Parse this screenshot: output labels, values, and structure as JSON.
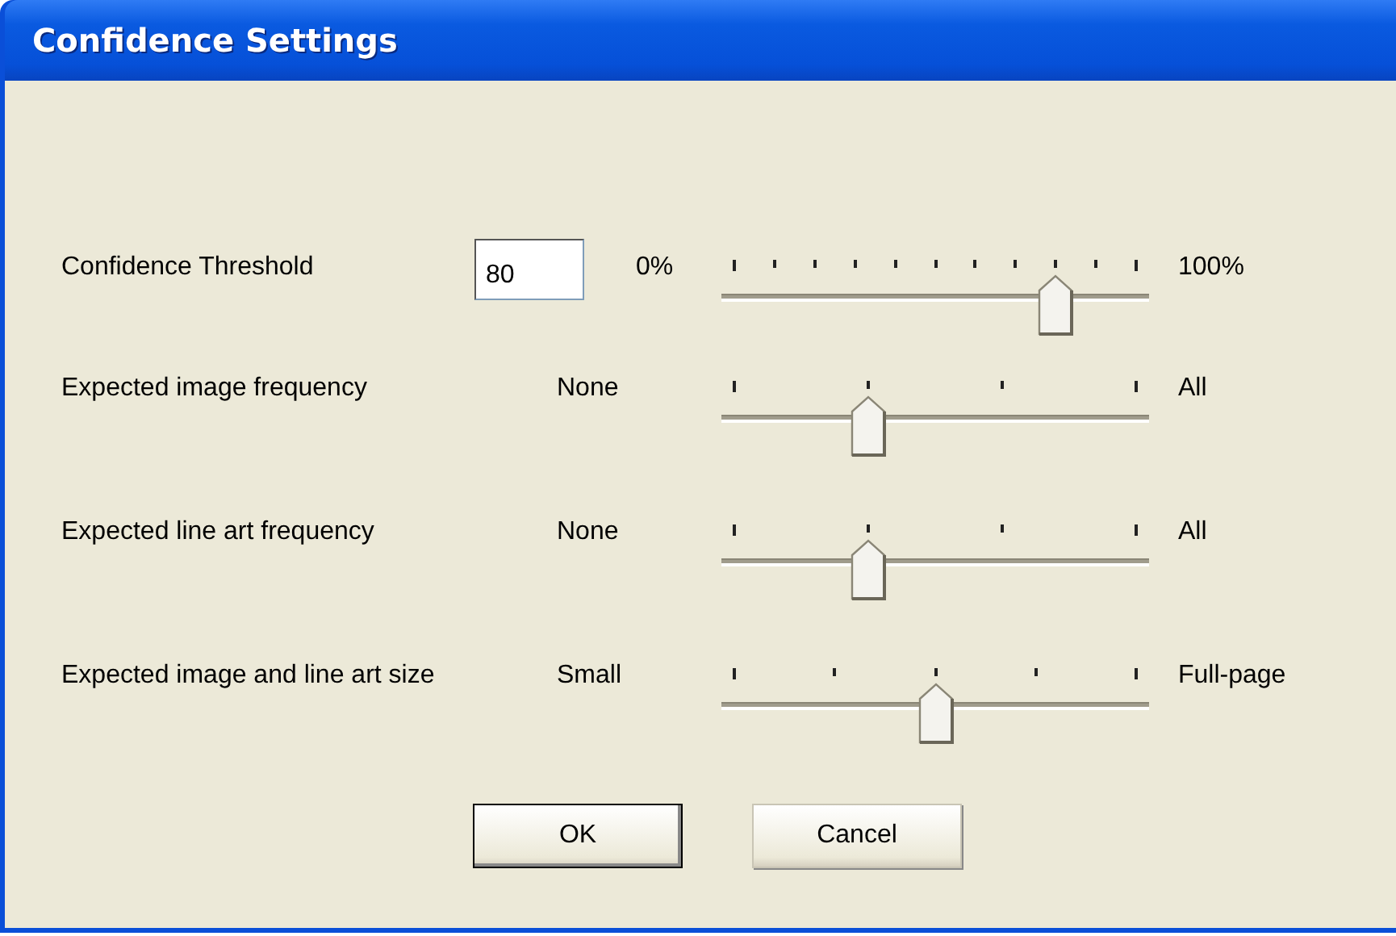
{
  "window": {
    "title": "Confidence Settings"
  },
  "settings": [
    {
      "label": "Confidence Threshold",
      "value": "80",
      "min_label": "0%",
      "max_label": "100%",
      "kind": "tenths",
      "level": 0.8
    },
    {
      "label": "Expected image frequency",
      "min_label": "None",
      "max_label": "All",
      "kind": "thirds",
      "level": 0.3333
    },
    {
      "label": "Expected line art frequency",
      "min_label": "None",
      "max_label": "All",
      "kind": "thirds",
      "level": 0.3333
    },
    {
      "label": "Expected image and line art size",
      "min_label": "Small",
      "max_label": "Full-page",
      "kind": "quarters",
      "level": 0.5
    }
  ],
  "buttons": [
    {
      "label": "OK",
      "default": true
    },
    {
      "label": "Cancel",
      "default": false
    }
  ]
}
